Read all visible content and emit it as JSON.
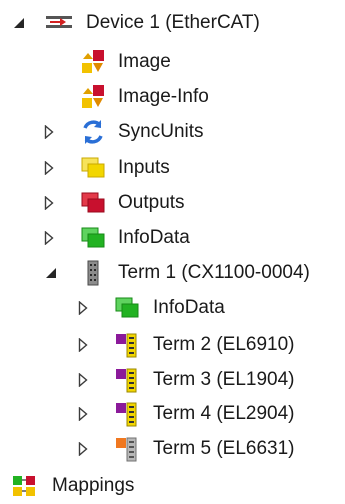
{
  "tree": {
    "device": {
      "label": "Device 1 (EtherCAT)",
      "icon": "ethercat-device-icon",
      "expanded": true
    },
    "device_children": [
      {
        "label": "Image",
        "icon": "image-icon",
        "expandable": false
      },
      {
        "label": "Image-Info",
        "icon": "image-info-icon",
        "expandable": false
      },
      {
        "label": "SyncUnits",
        "icon": "syncunits-icon",
        "expandable": true
      },
      {
        "label": "Inputs",
        "icon": "inputs-icon",
        "expandable": true
      },
      {
        "label": "Outputs",
        "icon": "outputs-icon",
        "expandable": true
      },
      {
        "label": "InfoData",
        "icon": "infodata-icon",
        "expandable": true
      }
    ],
    "term1": {
      "label": "Term 1 (CX1100-0004)",
      "icon": "terminal-coupler-icon",
      "expanded": true
    },
    "term1_children": [
      {
        "label": "InfoData",
        "icon": "infodata-icon",
        "expandable": true
      },
      {
        "label": "Term 2 (EL6910)",
        "icon": "terminal-purple-icon",
        "expandable": true
      },
      {
        "label": "Term 3 (EL1904)",
        "icon": "terminal-purple-icon",
        "expandable": true
      },
      {
        "label": "Term 4 (EL2904)",
        "icon": "terminal-purple-icon",
        "expandable": true
      },
      {
        "label": "Term 5 (EL6631)",
        "icon": "terminal-orange-icon",
        "expandable": true
      }
    ],
    "mappings": {
      "label": "Mappings",
      "icon": "mappings-icon"
    }
  },
  "colors": {
    "expanded_arrow": "#262626",
    "collapsed_arrow": "#3c3c3c",
    "inputs_yellow": "#f2d600",
    "outputs_red": "#c8102e",
    "infodata_green": "#22b222",
    "sync_blue": "#2a6fd6"
  }
}
